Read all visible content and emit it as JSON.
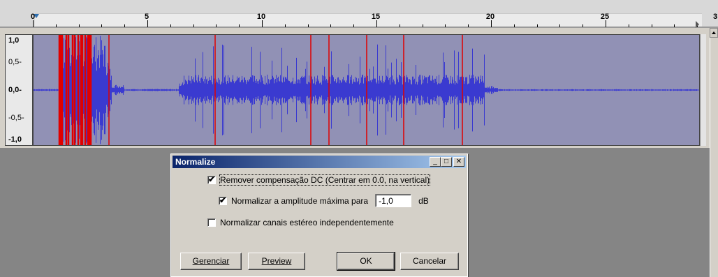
{
  "ruler": {
    "ticks": [
      "0",
      "5",
      "10",
      "15",
      "20",
      "25",
      "3"
    ]
  },
  "track": {
    "amplitude_labels": [
      "1,0",
      "0,5-",
      "0,0-",
      "-0,5-",
      "-1,0"
    ],
    "colors": {
      "waveform": "#3a3ad0",
      "background": "#9191b5",
      "clip": "#e00000"
    }
  },
  "dialog": {
    "title": "Normalize",
    "minimize_glyph": "_",
    "maximize_glyph": "□",
    "close_glyph": "✕",
    "remove_dc_label": "Remover compensação DC (Centrar em 0.0, na vertical)",
    "remove_dc_checked": true,
    "normalize_amp_label": "Normalizar a amplitude máxima para",
    "normalize_amp_checked": true,
    "amp_value": "-1,0",
    "amp_unit": "dB",
    "stereo_label": "Normalizar canais estéreo independentemente",
    "stereo_checked": false,
    "buttons": {
      "manage": "Gerenciar",
      "preview": "Preview",
      "ok": "OK",
      "cancel": "Cancelar"
    }
  }
}
